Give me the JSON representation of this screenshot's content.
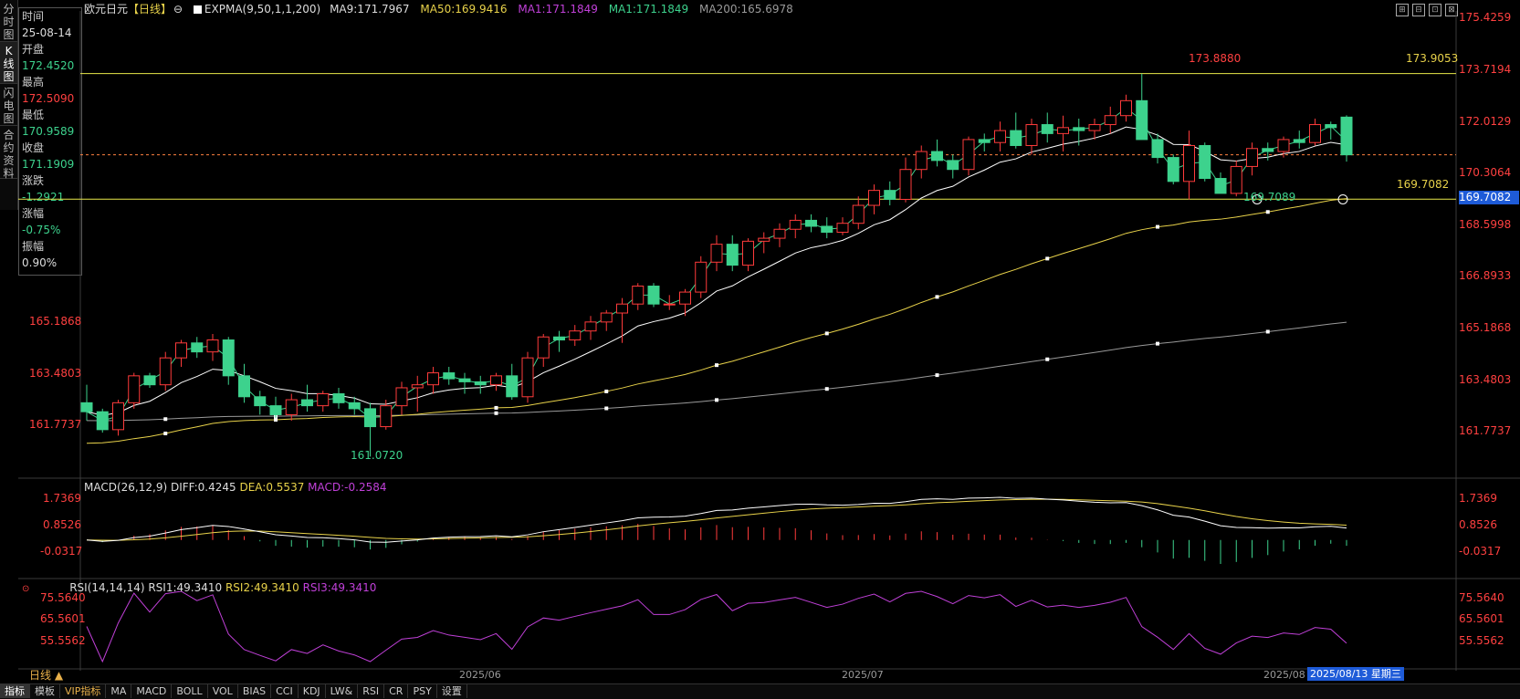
{
  "left_tabs": [
    {
      "label": "分时图"
    },
    {
      "label": "K线图"
    },
    {
      "label": "闪电图"
    },
    {
      "label": "合约资料"
    }
  ],
  "info": {
    "time_label": "时间",
    "time_value": "25-08-14",
    "open_label": "开盘",
    "open_value": "172.4520",
    "high_label": "最高",
    "high_value": "172.5090",
    "low_label": "最低",
    "low_value": "170.9589",
    "close_label": "收盘",
    "close_value": "171.1909",
    "change_label": "涨跌",
    "change_value": "-1.2921",
    "pct_label": "涨幅",
    "pct_value": "-0.75%",
    "amp_label": "振幅",
    "amp_value": "0.90%"
  },
  "header": {
    "symbol": "欧元日元",
    "period": "【日线】",
    "settings": "⊖",
    "indicator": "EXPMA(9,50,1,1,200)",
    "ma9": "MA9:171.7967",
    "ma50": "MA50:169.9416",
    "ma1a": "MA1:171.1849",
    "ma1b": "MA1:171.1849",
    "ma200": "MA200:165.6978"
  },
  "main_axis": [
    "175.4259",
    "173.7194",
    "172.0129",
    "170.3064",
    "168.5998",
    "166.8933",
    "165.1868",
    "163.4803",
    "161.7737"
  ],
  "main_axis_left": [
    "165.1868",
    "163.4803",
    "161.7737"
  ],
  "price_marks": {
    "high": "173.8880",
    "hline_upper": "173.9053",
    "low_mid": "169.7089",
    "hline_lower": "169.7082",
    "current": "169.7082",
    "low": "161.0720"
  },
  "macd": {
    "title": "MACD(26,12,9)",
    "diff": "DIFF:0.4245",
    "dea": "DEA:0.5537",
    "macd": "MACD:-0.2584",
    "axis": [
      "1.7369",
      "0.8526",
      "-0.0317"
    ]
  },
  "rsi": {
    "title": "RSI(14,14,14)",
    "rsi1": "RSI1:49.3410",
    "rsi2": "RSI2:49.3410",
    "rsi3": "RSI3:49.3410",
    "axis": [
      "75.5640",
      "65.5601",
      "55.5562"
    ]
  },
  "dates": [
    "2025/06",
    "2025/07",
    "2025/08"
  ],
  "cursor_date": "2025/08/13 星期三",
  "period_button": "日线 ▲",
  "tabs": [
    "指标",
    "模板",
    "VIP指标",
    "MA",
    "MACD",
    "BOLL",
    "VOL",
    "BIAS",
    "CCI",
    "KDJ",
    "LW&",
    "RSI",
    "CR",
    "PSY",
    "设置"
  ],
  "colors": {
    "up": "#ff3b3b",
    "down": "#3dd28d",
    "ma9": "#ffffff",
    "ma50": "#e8d24a",
    "ma200": "#9a9a9a",
    "rsi": "#c040d8",
    "hline": "#e8e84a"
  },
  "chart_data": {
    "type": "candlestick",
    "candles": [
      [
        162.9,
        163.5,
        162.3,
        162.6
      ],
      [
        162.6,
        162.7,
        161.9,
        162.0
      ],
      [
        162.0,
        163.0,
        161.8,
        162.9
      ],
      [
        162.9,
        163.9,
        162.7,
        163.8
      ],
      [
        163.8,
        163.9,
        163.4,
        163.5
      ],
      [
        163.5,
        164.6,
        163.3,
        164.4
      ],
      [
        164.4,
        165.0,
        164.1,
        164.9
      ],
      [
        164.9,
        165.1,
        164.4,
        164.6
      ],
      [
        164.6,
        165.2,
        164.3,
        165.0
      ],
      [
        165.0,
        165.1,
        163.5,
        163.8
      ],
      [
        163.8,
        164.2,
        162.9,
        163.1
      ],
      [
        163.1,
        163.3,
        162.5,
        162.8
      ],
      [
        162.8,
        163.1,
        162.4,
        162.5
      ],
      [
        162.5,
        163.2,
        162.3,
        163.0
      ],
      [
        163.0,
        163.5,
        162.6,
        162.8
      ],
      [
        162.8,
        163.3,
        162.6,
        163.2
      ],
      [
        163.2,
        163.4,
        162.7,
        162.9
      ],
      [
        162.9,
        163.1,
        162.5,
        162.7
      ],
      [
        162.7,
        162.9,
        161.1,
        162.1
      ],
      [
        162.1,
        163.0,
        162.0,
        162.8
      ],
      [
        162.8,
        163.6,
        162.5,
        163.4
      ],
      [
        163.4,
        163.8,
        162.6,
        163.5
      ],
      [
        163.5,
        164.1,
        163.2,
        163.9
      ],
      [
        163.9,
        164.1,
        163.5,
        163.7
      ],
      [
        163.7,
        163.9,
        163.2,
        163.6
      ],
      [
        163.6,
        163.8,
        163.2,
        163.5
      ],
      [
        163.5,
        163.9,
        163.3,
        163.8
      ],
      [
        163.8,
        164.2,
        163.0,
        163.1
      ],
      [
        163.1,
        164.6,
        162.9,
        164.4
      ],
      [
        164.4,
        165.2,
        164.1,
        165.1
      ],
      [
        165.1,
        165.3,
        164.6,
        165.0
      ],
      [
        165.0,
        165.5,
        164.8,
        165.3
      ],
      [
        165.3,
        165.8,
        165.0,
        165.6
      ],
      [
        165.6,
        166.0,
        165.3,
        165.9
      ],
      [
        165.9,
        166.4,
        164.9,
        166.2
      ],
      [
        166.2,
        166.9,
        166.0,
        166.8
      ],
      [
        166.8,
        166.9,
        166.1,
        166.2
      ],
      [
        166.2,
        166.5,
        166.0,
        166.2
      ],
      [
        166.2,
        166.7,
        165.8,
        166.6
      ],
      [
        166.6,
        167.8,
        166.4,
        167.6
      ],
      [
        167.6,
        168.5,
        167.3,
        168.2
      ],
      [
        168.2,
        168.5,
        167.3,
        167.5
      ],
      [
        167.5,
        168.4,
        167.3,
        168.3
      ],
      [
        168.3,
        168.6,
        167.9,
        168.4
      ],
      [
        168.4,
        168.9,
        168.1,
        168.7
      ],
      [
        168.7,
        169.2,
        168.4,
        169.0
      ],
      [
        169.0,
        169.2,
        168.6,
        168.8
      ],
      [
        168.8,
        169.1,
        168.4,
        168.6
      ],
      [
        168.6,
        169.1,
        168.5,
        168.9
      ],
      [
        168.9,
        169.8,
        168.7,
        169.5
      ],
      [
        169.5,
        170.2,
        169.2,
        170.0
      ],
      [
        170.0,
        170.3,
        169.5,
        169.7
      ],
      [
        169.7,
        171.1,
        169.6,
        170.7
      ],
      [
        170.7,
        171.5,
        170.4,
        171.3
      ],
      [
        171.3,
        171.7,
        170.8,
        171.0
      ],
      [
        171.0,
        171.2,
        170.4,
        170.7
      ],
      [
        170.7,
        171.8,
        170.5,
        171.7
      ],
      [
        171.7,
        171.9,
        171.3,
        171.6
      ],
      [
        171.6,
        172.3,
        171.3,
        172.0
      ],
      [
        172.0,
        172.6,
        171.4,
        171.5
      ],
      [
        171.5,
        172.4,
        171.2,
        172.2
      ],
      [
        172.2,
        172.6,
        171.6,
        171.9
      ],
      [
        171.9,
        172.5,
        171.3,
        172.1
      ],
      [
        172.1,
        172.4,
        171.5,
        172.0
      ],
      [
        172.0,
        172.4,
        171.7,
        172.2
      ],
      [
        172.2,
        172.8,
        171.9,
        172.5
      ],
      [
        172.5,
        173.2,
        172.3,
        173.0
      ],
      [
        173.0,
        173.9,
        172.1,
        171.7
      ],
      [
        171.7,
        171.9,
        170.9,
        171.1
      ],
      [
        171.1,
        171.2,
        170.2,
        170.3
      ],
      [
        170.3,
        172.0,
        169.7,
        171.5
      ],
      [
        171.5,
        171.6,
        170.3,
        170.4
      ],
      [
        170.4,
        170.6,
        169.9,
        169.9
      ],
      [
        169.9,
        171.0,
        169.8,
        170.8
      ],
      [
        170.8,
        171.6,
        170.5,
        171.4
      ],
      [
        171.4,
        171.6,
        171.0,
        171.3
      ],
      [
        171.3,
        171.8,
        171.1,
        171.7
      ],
      [
        171.7,
        172.0,
        171.4,
        171.6
      ],
      [
        171.6,
        172.4,
        171.5,
        172.2
      ],
      [
        172.2,
        172.3,
        171.7,
        172.1
      ],
      [
        172.45,
        172.51,
        170.96,
        171.19
      ]
    ],
    "ylim": [
      160.5,
      176.0
    ]
  }
}
